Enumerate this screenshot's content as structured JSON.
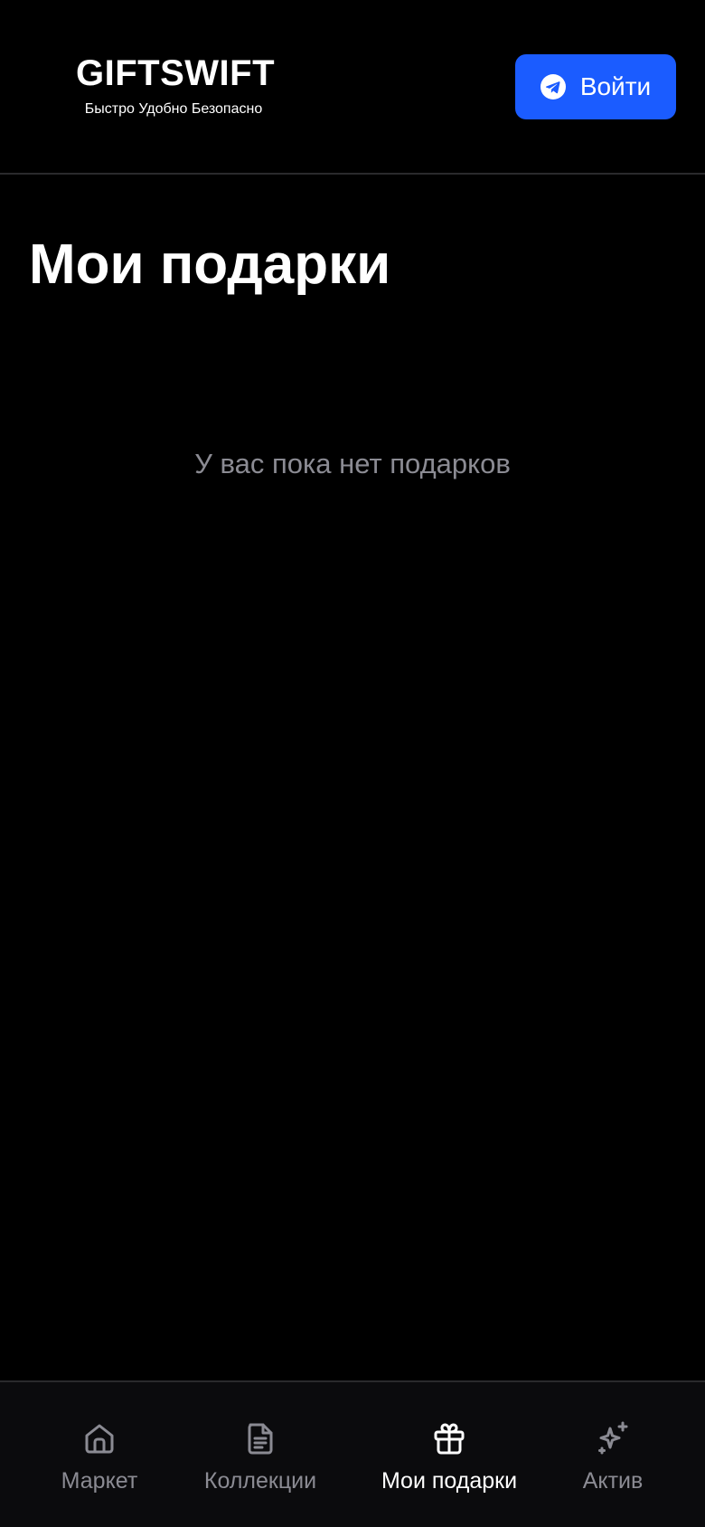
{
  "header": {
    "logo_title": "GIFTSWIFT",
    "logo_tagline": "Быстро Удобно Безопасно",
    "login_label": "Войти",
    "login_icon": "telegram-icon"
  },
  "main": {
    "title": "Мои подарки",
    "empty_message": "У вас пока нет подарков"
  },
  "bottom_nav": {
    "active_item": "Мои подарки",
    "items": [
      {
        "label": "Маркет",
        "icon": "home-icon",
        "active": false
      },
      {
        "label": "Коллекции",
        "icon": "document-icon",
        "active": false
      },
      {
        "label": "Мои подарки",
        "icon": "gift-icon",
        "active": true
      },
      {
        "label": "Актив",
        "icon": "sparkles-icon",
        "active": false
      }
    ]
  },
  "colors": {
    "background": "#000000",
    "accent": "#1b5cff",
    "muted_text": "#8b8b93",
    "nav_background": "#0b0b0d"
  }
}
